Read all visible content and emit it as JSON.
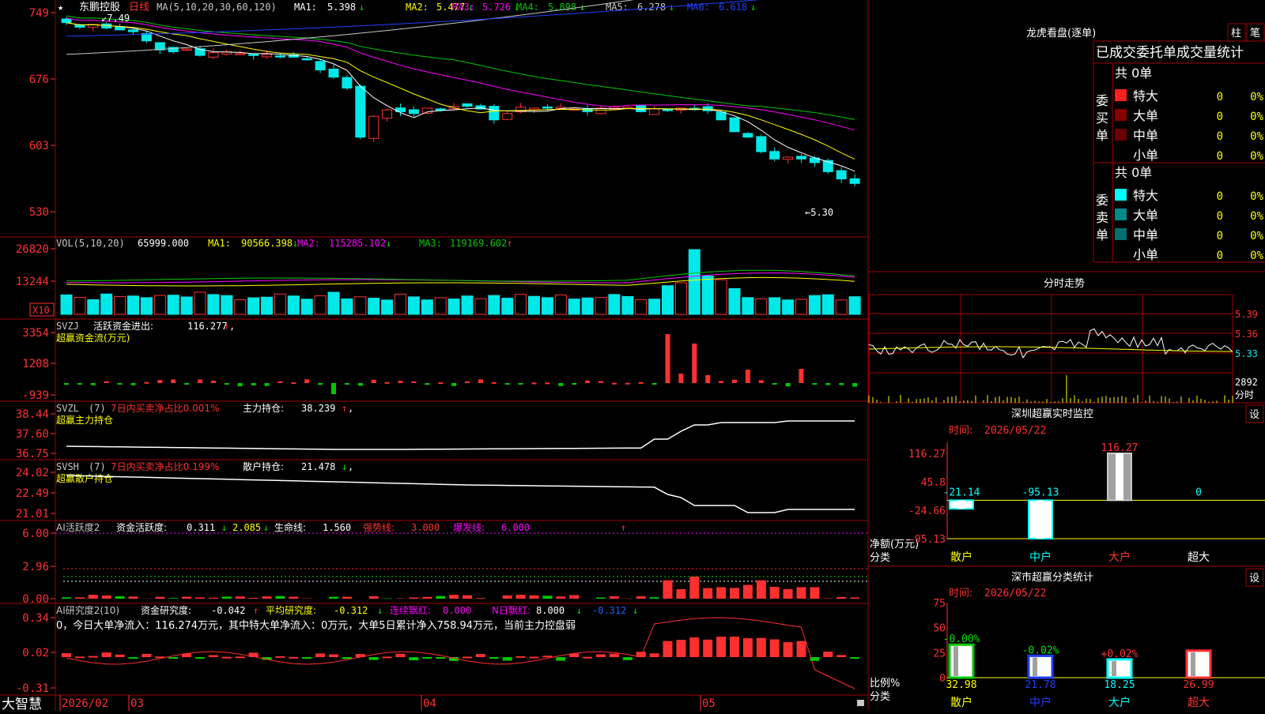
{
  "stock": {
    "name": "东鹏控股",
    "period": "日线",
    "star": "★"
  },
  "colors": {
    "up": "#ff3030",
    "down": "#00e8e8",
    "bg": "#000000",
    "grid": "#a00000",
    "axis": "#ff3030",
    "ma1": "#ffffff",
    "ma2": "#ffff00",
    "ma3": "#ff00ff",
    "ma4": "#00c800",
    "ma5": "#c8c8c8",
    "ma6": "#2040ff"
  },
  "kline": {
    "ma_header": "MA(5,10,20,30,60,120)",
    "ma": [
      {
        "label": "MA1:",
        "value": "5.398",
        "arrow": "↓"
      },
      {
        "label": "MA2:",
        "value": "5.477",
        "arrow": "↓"
      },
      {
        "label": "MA3:",
        "value": "5.726",
        "arrow": "↓"
      },
      {
        "label": "MA4:",
        "value": "5.898",
        "arrow": "↓"
      },
      {
        "label": "MA5:",
        "value": "6.278",
        "arrow": "↓"
      },
      {
        "label": "MA6:",
        "value": "6.618",
        "arrow": "↓"
      }
    ],
    "yticks": [
      "749",
      "676",
      "603",
      "530"
    ],
    "high_mark": "7.49",
    "low_mark": "5.30"
  },
  "vol": {
    "header": "VOL(5,10,20)",
    "value": "65999.000",
    "ma": [
      {
        "label": "MA1:",
        "value": "90566.398",
        "arrow": "↓"
      },
      {
        "label": "MA2:",
        "value": "115285.102",
        "arrow": "↓"
      },
      {
        "label": "MA3:",
        "value": "119169.602",
        "arrow": "↑"
      }
    ],
    "yticks": [
      "26820",
      "13244"
    ],
    "unit": "X10"
  },
  "svzj": {
    "name": "SVZJ",
    "item": "活跃资金进出:",
    "value": "116.277",
    "arrow": "↑",
    "comma": ",",
    "subtitle": "超赢资金流(万元)",
    "yticks": [
      "3354",
      "1208",
      "-939"
    ]
  },
  "svzl": {
    "name": "SVZL",
    "param": "(7)",
    "item1": "7日内买卖净占比0.001%",
    "item2": "主力持仓:",
    "value": "38.239",
    "arrow": "↑",
    "comma": ",",
    "subtitle": "超赢主力持仓",
    "yticks": [
      "38.44",
      "37.60",
      "36.75"
    ]
  },
  "svsh": {
    "name": "SVSH",
    "param": "(7)",
    "item1": "7日内买卖净占比0.199%",
    "item2": "散户持仓:",
    "value": "21.478",
    "arrow": "↓",
    "comma": ",",
    "subtitle": "超赢散户持仓",
    "yticks": [
      "24.02",
      "22.49",
      "21.01"
    ]
  },
  "ai1": {
    "name": "AI活跃度2",
    "item1": "资金活跃度:",
    "v1": "0.311",
    "a1": "↓",
    "v2": "2.085",
    "a2": "↓",
    "item2": "生命线:",
    "v3": "1.560",
    "item3": "强势线:",
    "v4": "3.000",
    "item4": "爆发线:",
    "v5": "6.000",
    "up": "↑",
    "yticks": [
      "6.00",
      "2.96",
      "0.00"
    ]
  },
  "ai2": {
    "name": "AI研究度2(10)",
    "item1": "资金研究度:",
    "v1": "-0.042",
    "a1": "↑",
    "item2": "平均研究度:",
    "v2": "-0.312",
    "a2": "↓",
    "item3": "连续飘红:",
    "v3": "0.000",
    "item4": "N日飘红:",
    "v4": "8.000",
    "a4": "↓",
    "v5": "-0.312",
    "a5": "↓",
    "comment": "0，今日大单净流入：116.274万元，其中特大单净流入：0万元，大单5日累计净入758.94万元，当前主力控盘弱",
    "yticks": [
      "0.34",
      "0.02",
      "-0.31"
    ]
  },
  "xaxis": {
    "labels": [
      "2026/02",
      "03",
      "04",
      "05"
    ],
    "brand": "大智慧"
  },
  "dragon": {
    "title": "龙虎看盘(逐单)",
    "btn1": "柱",
    "btn2": "笔",
    "subtitle": "已成交委托单成交量统计",
    "buy": {
      "label": "委买单",
      "total": "共 0单",
      "rows": [
        {
          "name": "特大",
          "count": "0",
          "pct": "0%",
          "color": "#ff2020"
        },
        {
          "name": "大单",
          "count": "0",
          "pct": "0%",
          "color": "#8a0000"
        },
        {
          "name": "中单",
          "count": "0",
          "pct": "0%",
          "color": "#6a0000"
        },
        {
          "name": "小单",
          "count": "0",
          "pct": "0%",
          "color": "#000000"
        }
      ]
    },
    "sell": {
      "label": "委卖单",
      "total": "共 0单",
      "rows": [
        {
          "name": "特大",
          "count": "0",
          "pct": "0%",
          "color": "#00ffff"
        },
        {
          "name": "大单",
          "count": "0",
          "pct": "0%",
          "color": "#008a8a"
        },
        {
          "name": "中单",
          "count": "0",
          "pct": "0%",
          "color": "#007070"
        },
        {
          "name": "小单",
          "count": "0",
          "pct": "0%",
          "color": "#000000"
        }
      ]
    }
  },
  "intraday": {
    "title": "分时走势",
    "yticks": [
      "5.39",
      "5.36",
      "5.33"
    ],
    "vol_tick": "2892",
    "vol_unit": "分时"
  },
  "monitor": {
    "title": "深圳超赢实时监控",
    "btn": "设",
    "time_label": "时间:",
    "time": "2026/05/22",
    "yticks": [
      "116.27",
      "45.8",
      "-24.66",
      "-95.13"
    ],
    "ylabel": "净额(万元)",
    "xlabel": "分类",
    "chart_data": {
      "type": "bar",
      "categories": [
        "散户",
        "中户",
        "大户",
        "超大"
      ],
      "values": [
        -21.14,
        -95.13,
        116.27,
        0
      ],
      "value_labels": [
        "-21.14",
        "-95.13",
        "116.27",
        "0"
      ],
      "ylim": [
        -95.13,
        116.27
      ]
    }
  },
  "classify": {
    "title": "深市超赢分类统计",
    "btn": "设",
    "time_label": "时间:",
    "time": "2026/05/22",
    "yticks": [
      "75",
      "50",
      "25",
      "0"
    ],
    "ylabel": "比例%",
    "xlabel": "分类",
    "chart_data": {
      "type": "bar",
      "categories": [
        "散户",
        "中户",
        "大户",
        "超大"
      ],
      "values": [
        32.98,
        21.78,
        18.25,
        26.99
      ],
      "value_labels": [
        "32.98",
        "21.78",
        "18.25",
        "26.99"
      ],
      "change_labels": [
        "-0.00%",
        "-0.02%",
        "+0.02%",
        ""
      ],
      "ylim": [
        0,
        75
      ]
    }
  }
}
